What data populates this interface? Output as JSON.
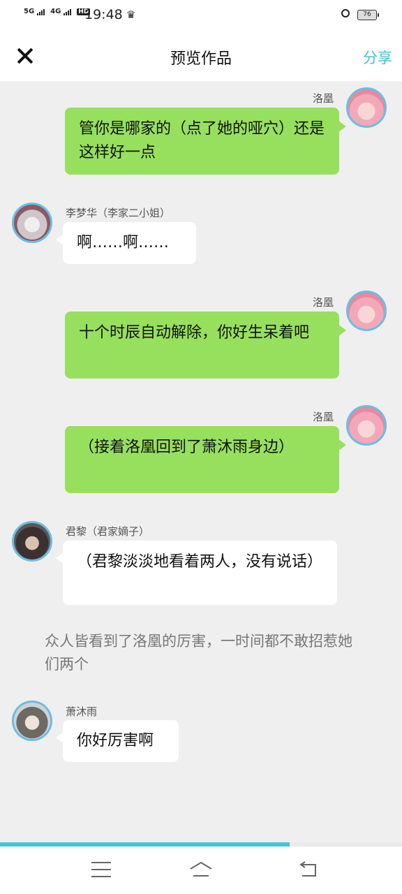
{
  "status_bar": {
    "net1": "5G",
    "net2": "4G",
    "hd": "HD",
    "time": "19:48",
    "battery": "76"
  },
  "header": {
    "title": "预览作品",
    "share_label": "分享"
  },
  "messages": [
    {
      "speaker": "洛凰",
      "text": "管你是哪家的（点了她的哑穴）还是这样好一点"
    },
    {
      "speaker": "李梦华（李家二小姐）",
      "text": "啊……啊……"
    },
    {
      "speaker": "洛凰",
      "text": "十个时辰自动解除，你好生呆着吧"
    },
    {
      "speaker": "洛凰",
      "text": "（接着洛凰回到了萧沐雨身边）"
    },
    {
      "speaker": "君黎（君家嫡子）",
      "text": "（君黎淡淡地看着两人，没有说话）"
    },
    {
      "narration": "众人皆看到了洛凰的厉害，一时间都不敢招惹她们两个"
    },
    {
      "speaker": "萧沐雨",
      "text": "你好厉害啊"
    }
  ],
  "progress": {
    "percent": 72
  }
}
